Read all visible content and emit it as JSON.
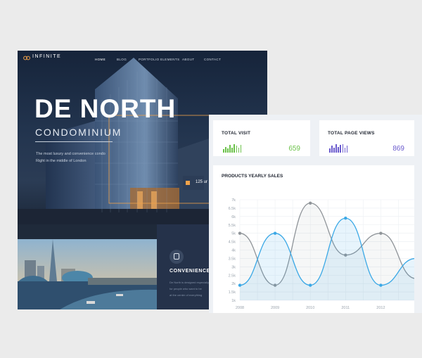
{
  "site": {
    "logo": {
      "name": "INFINITE",
      "tagline": ""
    },
    "nav": [
      {
        "label": "HOME",
        "active": true
      },
      {
        "label": "BLOG",
        "active": false
      },
      {
        "label": "PORTFOLIO",
        "active": false
      },
      {
        "label": "ELEMENTS",
        "active": false
      },
      {
        "label": "ABOUT",
        "active": false
      },
      {
        "label": "CONTACT",
        "active": false
      }
    ],
    "hero": {
      "title": "DE NORTH",
      "subtitle": "CONDOMINIUM",
      "desc_line1": "The most luxury and convenience condo",
      "desc_line2": "Right in the middle of London",
      "cta_text": "125 ur"
    },
    "feature": {
      "title": "CONVENIENCE",
      "text_line1": "De North is designed especially",
      "text_line2": "for people who want to be",
      "text_line3": "at the center of everything"
    }
  },
  "dashboard": {
    "colors": {
      "green": "#6cc24a",
      "purple": "#6a5acd",
      "blue": "#3aa8e6",
      "gray": "#8f9499"
    },
    "stats": [
      {
        "label": "TOTAL VISIT",
        "value": "659",
        "bars": [
          4,
          7,
          5,
          9,
          6,
          10,
          8,
          6,
          9
        ],
        "color": "#6cc24a"
      },
      {
        "label": "TOTAL PAGE VIEWS",
        "value": "869",
        "bars": [
          5,
          8,
          6,
          10,
          7,
          9,
          10,
          6,
          8
        ],
        "color": "#6a5acd"
      }
    ],
    "chart_title": "PRODUCTS YEARLY SALES"
  },
  "chart_data": {
    "type": "line",
    "title": "PRODUCTS YEARLY SALES",
    "x": [
      2008,
      2009,
      2010,
      2011,
      2012,
      2013
    ],
    "xticklabels": [
      "2008",
      "2009",
      "2010",
      "2011",
      "2012"
    ],
    "yticklabels": [
      "1k",
      "1.5k",
      "2k",
      "2.5k",
      "3k",
      "3.5k",
      "4k",
      "4.5k",
      "5k",
      "5.5k",
      "6k",
      "6.5k",
      "7k"
    ],
    "ylim": [
      1000,
      7000
    ],
    "grid": true,
    "series": [
      {
        "color": "#3aa8e6",
        "fill": true,
        "values": [
          1900,
          5000,
          1900,
          5900,
          1900,
          3500
        ]
      },
      {
        "color": "#8f9499",
        "fill": true,
        "values": [
          5000,
          1900,
          6800,
          3700,
          5000,
          2300
        ]
      }
    ]
  }
}
